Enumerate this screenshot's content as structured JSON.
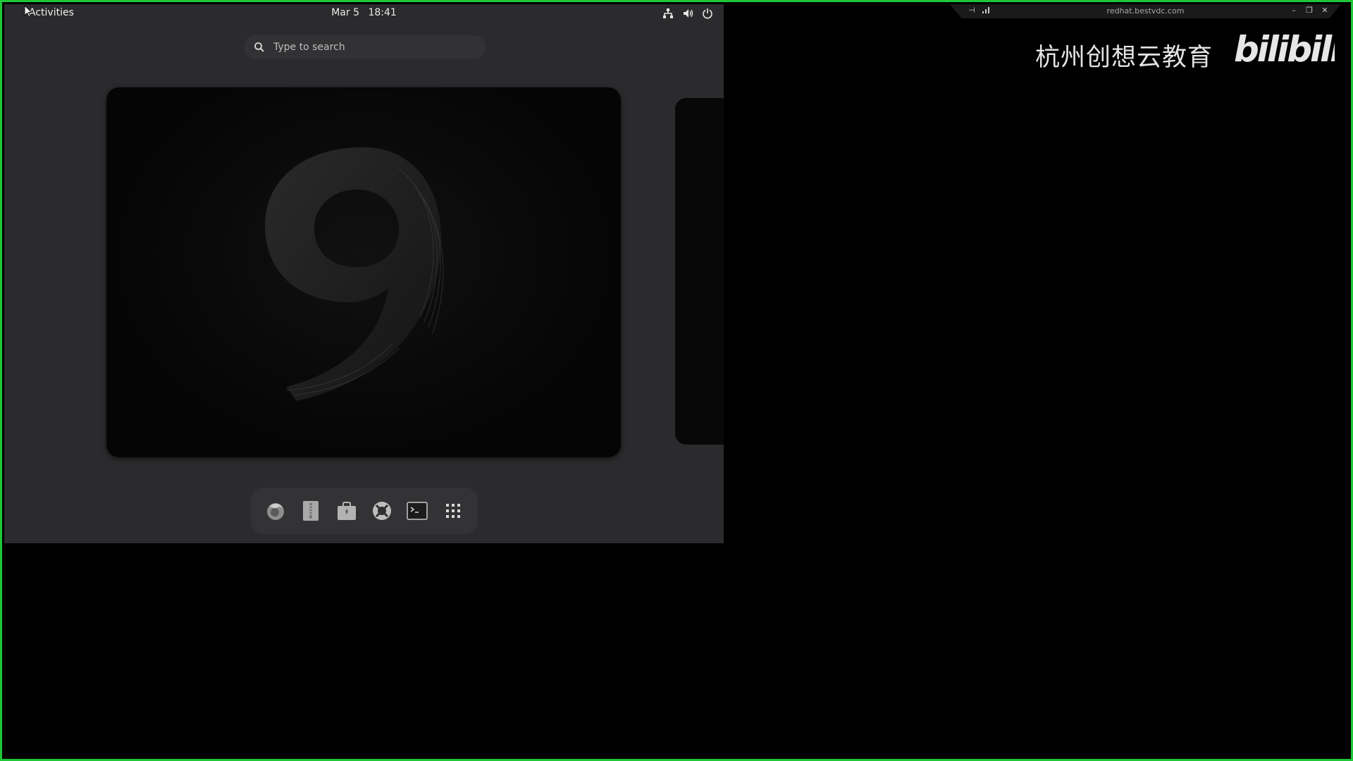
{
  "topbar": {
    "activities_label": "Activities",
    "date": "Mar 5",
    "time": "18:41",
    "status_icons": [
      "network-icon",
      "volume-icon",
      "power-icon"
    ]
  },
  "search": {
    "placeholder": "Type to search"
  },
  "dash": {
    "apps": [
      {
        "name": "Firefox",
        "icon": "firefox-icon"
      },
      {
        "name": "Files",
        "icon": "files-icon"
      },
      {
        "name": "Software",
        "icon": "software-icon"
      },
      {
        "name": "Help",
        "icon": "help-icon"
      },
      {
        "name": "Terminal",
        "icon": "terminal-icon"
      },
      {
        "name": "Show Applications",
        "icon": "app-grid-icon"
      }
    ]
  },
  "viewer": {
    "host": "redhat.bestvdc.com"
  },
  "watermark": {
    "org": "杭州创想云教育",
    "logo_text": "bilibili"
  },
  "colors": {
    "frame_border": "#1fc635",
    "shell_background": "#2b2b2d",
    "dash_background": "#333335"
  }
}
